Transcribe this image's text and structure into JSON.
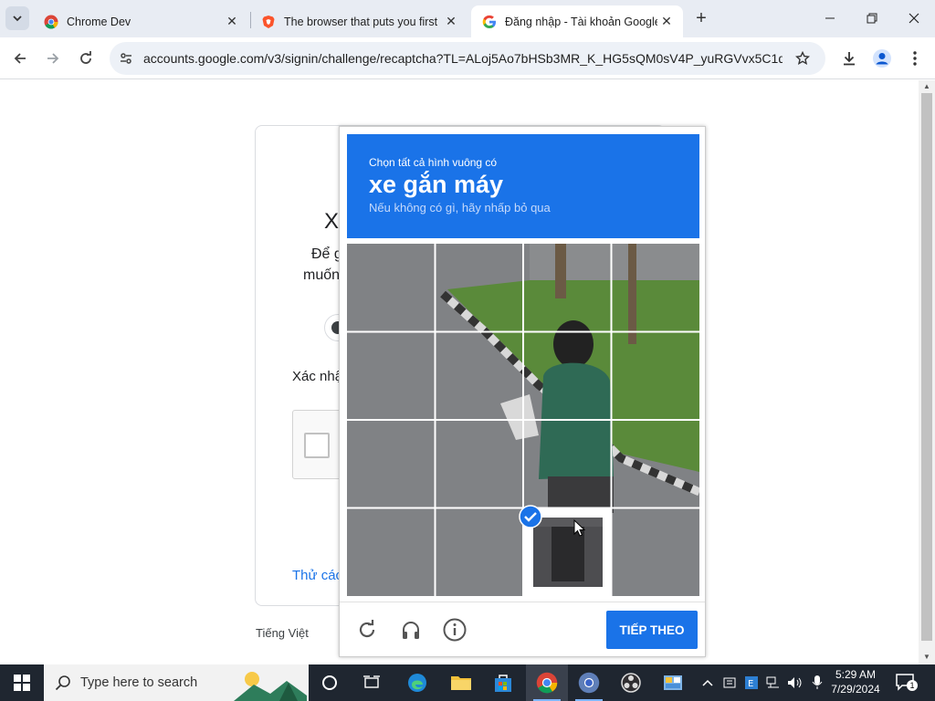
{
  "browser": {
    "tabs": [
      {
        "title": "Chrome Dev",
        "favicon": "chrome-dev-icon",
        "active": false
      },
      {
        "title": "The browser that puts you first",
        "favicon": "brave-icon",
        "active": false
      },
      {
        "title": "Đăng nhập - Tài khoản Google",
        "favicon": "google-icon",
        "active": true
      }
    ],
    "url": "accounts.google.com/v3/signin/challenge/recaptcha?TL=ALoj5Ao7bHSb3MR_K_HG5sQM0sV4P_yuRGVvx5C1qxj..."
  },
  "signin": {
    "heading_partial": "X",
    "line1_partial": "Để g",
    "line2_partial": "muốn",
    "confirm_partial": "Xác nhậ",
    "try_other_partial": "Thử các",
    "language": "Tiếng Việt"
  },
  "captcha": {
    "instruction": "Chọn tất cả hình vuông có",
    "target": "xe gắn máy",
    "hint": "Nếu không có gì, hãy nhấp bỏ qua",
    "selected_tiles": [
      14
    ],
    "next_button": "TIẾP THEO",
    "colors": {
      "header": "#1a73e8",
      "button": "#1a73e8"
    }
  },
  "taskbar": {
    "search_placeholder": "Type here to search",
    "time": "5:29 AM",
    "date": "7/29/2024",
    "notification_count": "1"
  }
}
